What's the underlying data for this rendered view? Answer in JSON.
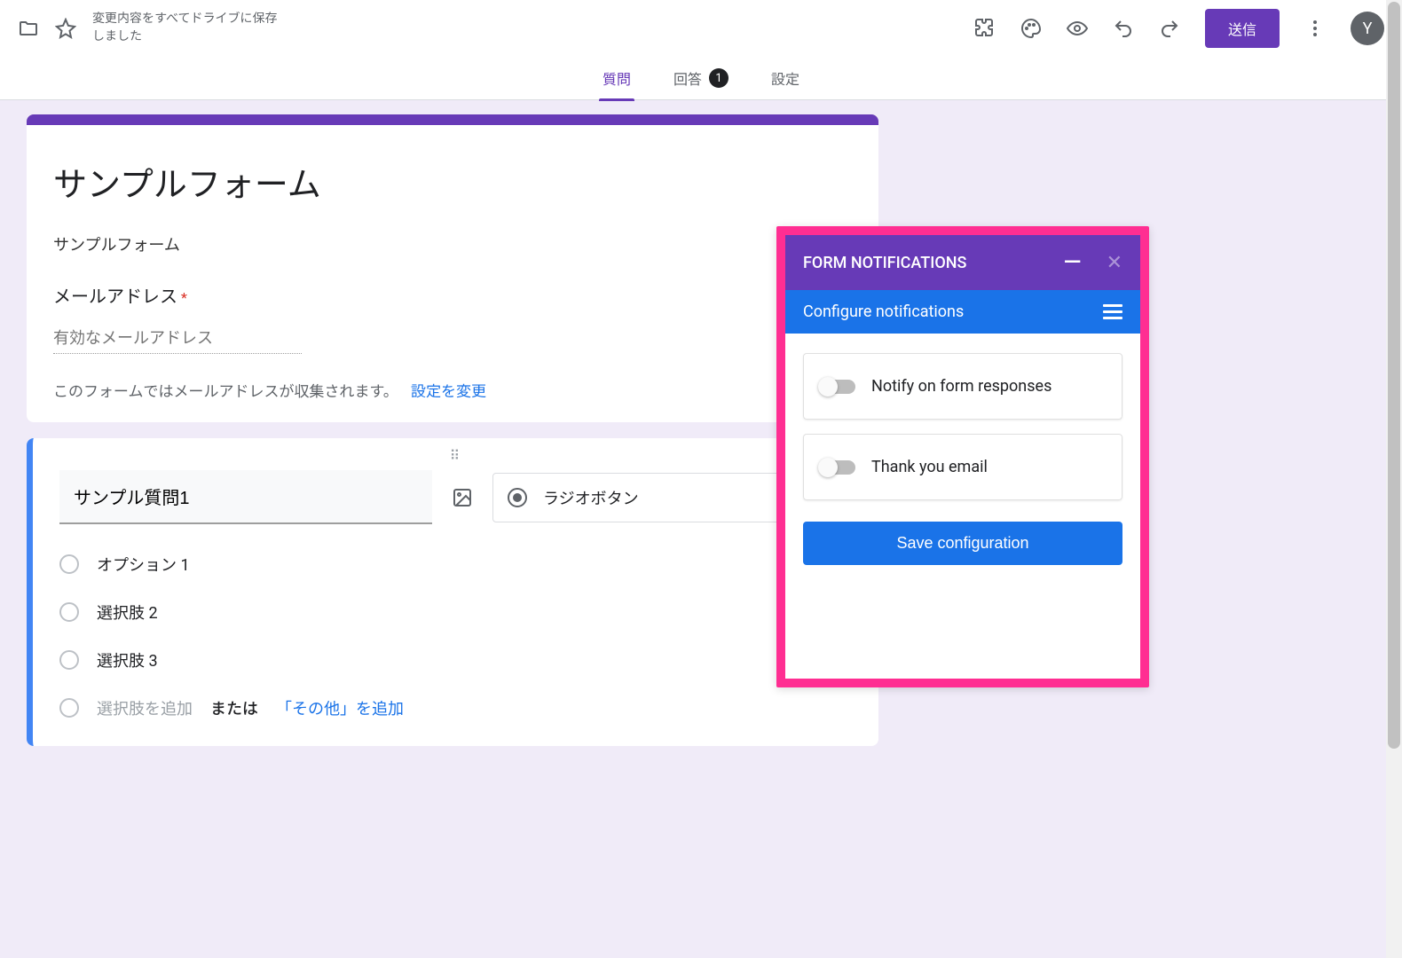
{
  "header": {
    "save_status": "変更内容をすべてドライブに保存しました",
    "send_label": "送信",
    "avatar_letter": "Y"
  },
  "tabs": {
    "questions": "質問",
    "responses": "回答",
    "response_count": "1",
    "settings": "設定"
  },
  "form": {
    "title": "サンプルフォーム",
    "description": "サンプルフォーム",
    "email_label": "メールアドレス",
    "email_placeholder": "有効なメールアドレス",
    "email_note": "このフォームではメールアドレスが収集されます。",
    "email_settings_link": "設定を変更"
  },
  "question": {
    "title": "サンプル質問1",
    "type_label": "ラジオボタン",
    "options": [
      "オプション 1",
      "選択肢 2",
      "選択肢 3"
    ],
    "add_option": "選択肢を追加",
    "or": "または",
    "add_other": "「その他」を追加"
  },
  "addon": {
    "title": "FORM NOTIFICATIONS",
    "subtitle": "Configure notifications",
    "toggle1": "Notify on form responses",
    "toggle2": "Thank you email",
    "save": "Save configuration"
  }
}
